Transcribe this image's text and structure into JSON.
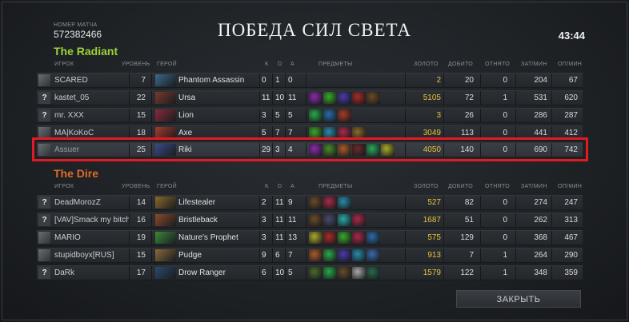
{
  "match": {
    "label": "НОМЕР МАТЧА",
    "id": "572382466",
    "title": "ПОБЕДА СИЛ СВЕТА",
    "time": "43:44"
  },
  "headers": {
    "player": "ИГРОК",
    "level": "УРОВЕНЬ",
    "hero": "ГЕРОЙ",
    "k": "K",
    "d": "D",
    "a": "A",
    "items": "ПРЕДМЕТЫ",
    "gold": "ЗОЛОТО",
    "lasthits": "ДОБИТО",
    "denies": "ОТНЯТО",
    "xpm": "ЗАТ/МИН",
    "gpm": "ОП/МИН"
  },
  "radiant": {
    "name": "The Radiant",
    "players": [
      {
        "avatar": "",
        "player": "SCARED",
        "level": "7",
        "hero": "Phantom Assassin",
        "k": "0",
        "d": "1",
        "a": "0",
        "gold": "2",
        "lasthits": "20",
        "denies": "0",
        "xpm": "204",
        "gpm": "67",
        "hero_color": "#3a6a8a",
        "item_colors": []
      },
      {
        "avatar": "?",
        "player": "kastet_05",
        "level": "22",
        "hero": "Ursa",
        "k": "11",
        "d": "10",
        "a": "11",
        "gold": "5105",
        "lasthits": "72",
        "denies": "1",
        "xpm": "531",
        "gpm": "620",
        "hero_color": "#7a3a2a",
        "item_colors": [
          "#8a2aa8",
          "#3aa82a",
          "#4a3aa8",
          "#a82a2a",
          "#6a4a2a"
        ]
      },
      {
        "avatar": "?",
        "player": "mr. XXX",
        "level": "15",
        "hero": "Lion",
        "k": "3",
        "d": "5",
        "a": "5",
        "gold": "3",
        "lasthits": "26",
        "denies": "0",
        "xpm": "286",
        "gpm": "287",
        "hero_color": "#8a2a3a",
        "item_colors": [
          "#2aa84a",
          "#2a6aa8",
          "#a83a2a"
        ]
      },
      {
        "avatar": "",
        "player": "MA|KoKoC",
        "level": "18",
        "hero": "Axe",
        "k": "5",
        "d": "7",
        "a": "7",
        "gold": "3049",
        "lasthits": "113",
        "denies": "0",
        "xpm": "441",
        "gpm": "412",
        "hero_color": "#a83a2a",
        "item_colors": [
          "#3aa82a",
          "#2a8aa8",
          "#a82a4a",
          "#8a6a2a"
        ]
      },
      {
        "avatar": "",
        "player": "Assuer",
        "level": "25",
        "hero": "Riki",
        "k": "29",
        "d": "3",
        "a": "4",
        "gold": "4050",
        "lasthits": "140",
        "denies": "0",
        "xpm": "690",
        "gpm": "742",
        "hero_color": "#3a4a8a",
        "item_colors": [
          "#8a2aa8",
          "#4a8a2a",
          "#a85a2a",
          "#6a2a2a",
          "#2aa85a",
          "#a8a82a"
        ]
      }
    ]
  },
  "dire": {
    "name": "The Dire",
    "players": [
      {
        "avatar": "?",
        "player": "DeadMorozZ",
        "level": "14",
        "hero": "Lifestealer",
        "k": "2",
        "d": "11",
        "a": "9",
        "gold": "527",
        "lasthits": "82",
        "denies": "0",
        "xpm": "274",
        "gpm": "247",
        "hero_color": "#8a6a2a",
        "item_colors": [
          "#6a4a2a",
          "#a82a4a",
          "#2a8aa8"
        ]
      },
      {
        "avatar": "?",
        "player": "[VAV]Smack my bitch",
        "level": "16",
        "hero": "Bristleback",
        "k": "3",
        "d": "11",
        "a": "11",
        "gold": "1687",
        "lasthits": "51",
        "denies": "0",
        "xpm": "262",
        "gpm": "313",
        "hero_color": "#8a4a2a",
        "item_colors": [
          "#6a4a2a",
          "#4a4a6a",
          "#2aa8a8",
          "#a82a4a"
        ]
      },
      {
        "avatar": "",
        "player": "MARIO",
        "level": "19",
        "hero": "Nature's Prophet",
        "k": "3",
        "d": "11",
        "a": "13",
        "gold": "575",
        "lasthits": "129",
        "denies": "0",
        "xpm": "368",
        "gpm": "467",
        "hero_color": "#3a8a3a",
        "item_colors": [
          "#a8a82a",
          "#a82a2a",
          "#3aa82a",
          "#a82a4a",
          "#2a6aa8"
        ]
      },
      {
        "avatar": "",
        "player": "stupidboyx[RUS]",
        "level": "15",
        "hero": "Pudge",
        "k": "9",
        "d": "6",
        "a": "7",
        "gold": "913",
        "lasthits": "7",
        "denies": "1",
        "xpm": "264",
        "gpm": "290",
        "hero_color": "#8a6a3a",
        "item_colors": [
          "#a85a2a",
          "#2aa84a",
          "#4a3aa8",
          "#2a8aa8",
          "#3a6aa8"
        ]
      },
      {
        "avatar": "?",
        "player": "DaRk",
        "level": "17",
        "hero": "Drow Ranger",
        "k": "6",
        "d": "10",
        "a": "5",
        "gold": "1579",
        "lasthits": "122",
        "denies": "1",
        "xpm": "348",
        "gpm": "359",
        "hero_color": "#2a4a6a",
        "item_colors": [
          "#4a6a2a",
          "#2aa84a",
          "#6a4a2a",
          "#a8a8a8",
          "#2a6a4a"
        ]
      }
    ]
  },
  "close_label": "ЗАКРЫТЬ",
  "colors": {
    "radiant": "#9bd33a",
    "dire": "#e0692a",
    "gold": "#e8c23a",
    "highlight": "#e01b24"
  }
}
